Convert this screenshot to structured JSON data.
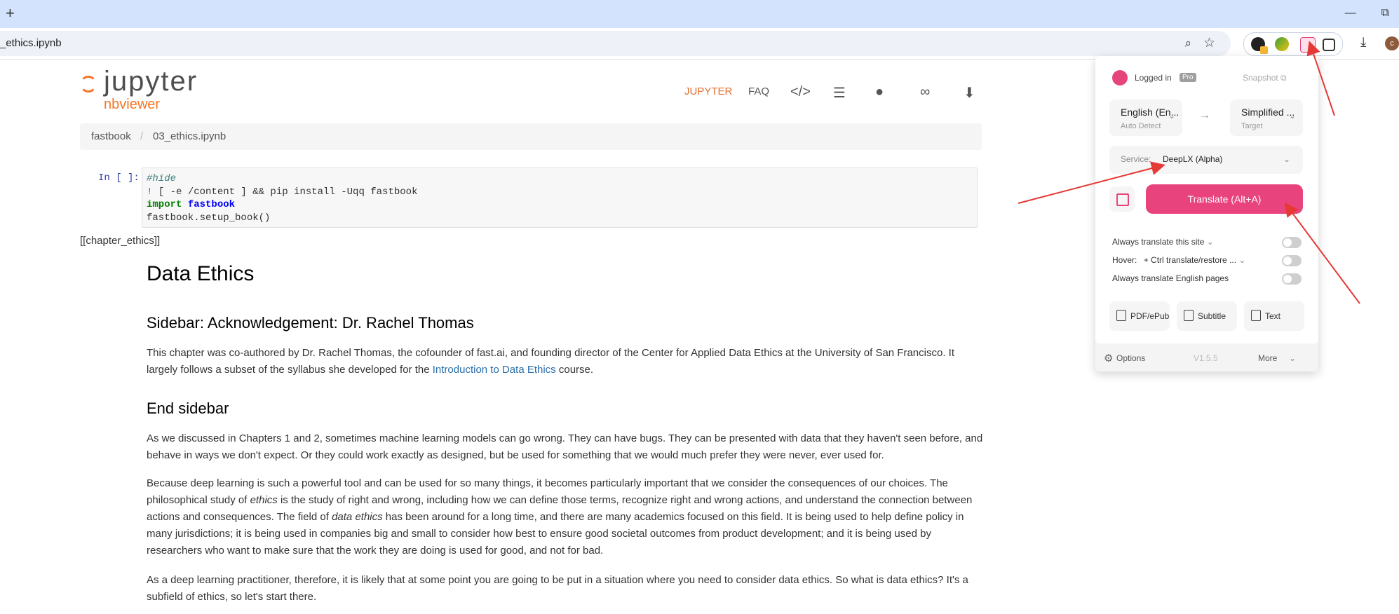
{
  "browser": {
    "new_tab": "+",
    "url": "_ethics.ipynb",
    "avatar_initial": "c"
  },
  "nbviewer": {
    "logo_main": "jupyter",
    "logo_sub": "nbviewer",
    "nav": {
      "jupyter": "JUPYTER",
      "faq": "FAQ"
    },
    "breadcrumb": [
      "fastbook",
      "/",
      "03_ethics.ipynb"
    ],
    "cell": {
      "prompt": "In [ ]:",
      "line1": "#hide",
      "line2_bang": "!",
      "line2_rest": " [ -e /content ] && pip install -Uqq fastbook",
      "line3_kw": "import",
      "line3_mod": "fastbook",
      "line4": "fastbook.setup_book()"
    },
    "raw": "[[chapter_ethics]]",
    "h1": "Data Ethics",
    "h2_sidebar": "Sidebar: Acknowledgement: Dr. Rachel Thomas",
    "p1_a": "This chapter was co-authored by Dr. Rachel Thomas, the cofounder of fast.ai, and founding director of the Center for Applied Data Ethics at the University of San Francisco. It largely follows a subset of the syllabus she developed for the ",
    "p1_link": "Introduction to Data Ethics",
    "p1_b": " course.",
    "h2_end": "End sidebar",
    "p2": "As we discussed in Chapters 1 and 2, sometimes machine learning models can go wrong. They can have bugs. They can be presented with data that they haven't seen before, and behave in ways we don't expect. Or they could work exactly as designed, but be used for something that we would much prefer they were never, ever used for.",
    "p3_a": "Because deep learning is such a powerful tool and can be used for so many things, it becomes particularly important that we consider the consequences of our choices. The philosophical study of ",
    "p3_em1": "ethics",
    "p3_b": " is the study of right and wrong, including how we can define those terms, recognize right and wrong actions, and understand the connection between actions and consequences. The field of ",
    "p3_em2": "data ethics",
    "p3_c": " has been around for a long time, and there are many academics focused on this field. It is being used to help define policy in many jurisdictions; it is being used in companies big and small to consider how best to ensure good societal outcomes from product development; and it is being used by researchers who want to make sure that the work they are doing is used for good, and not for bad.",
    "p4": "As a deep learning practitioner, therefore, it is likely that at some point you are going to be put in a situation where you need to consider data ethics. So what is data ethics? It's a subfield of ethics, so let's start there."
  },
  "popup": {
    "logged_in": "Logged in",
    "pro": "Pro",
    "snapshot": "Snapshot",
    "source_lang": "English (En...",
    "source_sub": "Auto Detect",
    "target_lang": "Simplified ...",
    "target_sub": "Target",
    "swap": "→",
    "service_label": "Service:",
    "service_value": "DeepLX (Alpha)",
    "translate_button": "Translate (Alt+A)",
    "always_site": "Always translate this site",
    "hover_label": "Hover:",
    "hover_value": "+ Ctrl translate/restore ...",
    "always_english": "Always translate English pages",
    "tools": [
      "PDF/ePub",
      "Subtitle",
      "Text"
    ],
    "options": "Options",
    "version": "V1.5.5",
    "more": "More"
  },
  "colors": {
    "tabstrip": "#d3e3fd",
    "jupyter_orange": "#f37626",
    "translate_pink": "#e8437c",
    "annotation_red": "#e53935"
  }
}
